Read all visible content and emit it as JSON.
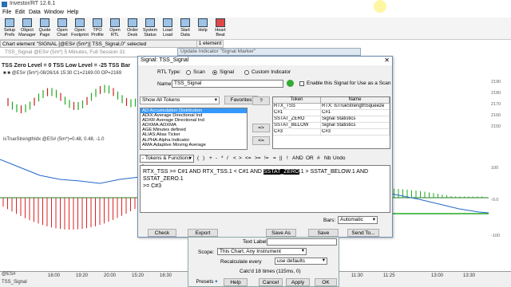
{
  "app": {
    "title": "Investor/RT 12.6.1"
  },
  "menu": [
    "File",
    "Edit",
    "Data",
    "Window",
    "Help"
  ],
  "toolbar": [
    "Setup Prefs",
    "Object Manager",
    "Quote Page",
    "Open Chart",
    "Open Footprint",
    "TPO Profile",
    "Open RTL",
    "Order Desk",
    "System Status",
    "Load Load",
    "Start Data",
    "Help",
    "Heart Beat"
  ],
  "status": {
    "selected": "Chart element \"SIGNAL [@ES# (5m*)] TSS_Signal,0\" selected",
    "count": "1 element"
  },
  "chart": {
    "title": "TSS_Signal @ES# (5m*) 5 Minutes, Full Session 31",
    "tss": "TSS Zero Level = 0 TSS Low Level = -25 TSS Bar",
    "info": "■ ■ @ES# (5m*)-08/26/16 15:30 C1=2169.00 OP=2169",
    "indicator": "isTrueStrengthIdx @ES# (5m*)=0.48, 0.48, -1.0",
    "right_axis": [
      "2190",
      "2180",
      "2170",
      "2160",
      "2150",
      "100",
      "-0.0",
      "-100"
    ],
    "bottom_sym": "@ES#",
    "bottom_tab": "TSS_Signal",
    "times": [
      "16:00",
      "19:20",
      "20:00",
      "15:20",
      "16:30",
      "17:00",
      "18:00",
      "16:00",
      "19:50",
      "20:00",
      "11:30",
      "11:25",
      "13:00",
      "13:30"
    ]
  },
  "update_window": {
    "title": "Update Indicator \"Signal Marker\""
  },
  "signal_dialog": {
    "title": "Signal: TSS_Signal",
    "rtl_type_label": "RTL Type:",
    "rtl_types": [
      "Scan",
      "Signal",
      "Custom Indicator"
    ],
    "selected_type": "Signal",
    "name_label": "Name:",
    "name_value": "TSS_Signal",
    "enable_scan_label": "Enable this Signal for Use as a Scan",
    "tokens_filter": "Show All Tokens",
    "favorites_label": "Favorites",
    "token_list": [
      "AD:Accumulation Distribution",
      "ADIX:Average Directional Ind",
      "ADXR:Average Directional Ind",
      "ADXMA:ADXMA",
      "AGE:Minutes defined",
      "ALIAS:Alias Ticker",
      "ALPHA:Alpha Indicator",
      "AMA:Adaptive Moving Average"
    ],
    "move_buttons": [
      "?",
      "=>",
      "<="
    ],
    "grid_headers": [
      "Token",
      "Name"
    ],
    "grid_rows": [
      [
        "RTX_TSS",
        "RTX: IsTrueStrengthSqueeze"
      ],
      [
        "C#1",
        "C#1"
      ],
      [
        "SSTAT_ZERO",
        "Signal Statistics"
      ],
      [
        "SSTAT_BELOW",
        "Signal Statistics"
      ],
      [
        "C#3",
        "C#3"
      ]
    ],
    "tokens_functions": "- Tokens & Functions -",
    "operators": [
      "(",
      ")",
      "+",
      "-",
      "*",
      "/",
      "<",
      ">",
      "<=",
      ">=",
      "!=",
      "=",
      "||",
      "!",
      "AND",
      "OR",
      "#",
      "Nb",
      "Undo"
    ],
    "expression_pre": "RTX_TSS >= C#1 AND RTX_TSS.1 < C#1 AND ",
    "expression_hl": "SSTAT_ZERO",
    "expression_post": ".1 > SSTAT_BELOW.1 AND SSTAT_ZERO.1",
    "expression_line2": ">= C#3",
    "bars_label": "Bars:",
    "bars_value": "Automatic",
    "buttons": {
      "check": "Check",
      "export": "Export",
      "save_as": "Save As",
      "save": "Save",
      "send_to": "Send To..."
    }
  },
  "lower_panel": {
    "text_label": "Text Label:",
    "scope_label": "Scope:",
    "scope_value": "This Chart, Any Instrument",
    "recalc_label": "Recalculate every",
    "recalc_value": "use defaults",
    "calc_info": "Calc'd 18 times (115ms, 0)",
    "buttons": {
      "presets": "Presets",
      "help": "Help",
      "cancel": "Cancel",
      "apply": "Apply",
      "ok": "OK"
    }
  }
}
